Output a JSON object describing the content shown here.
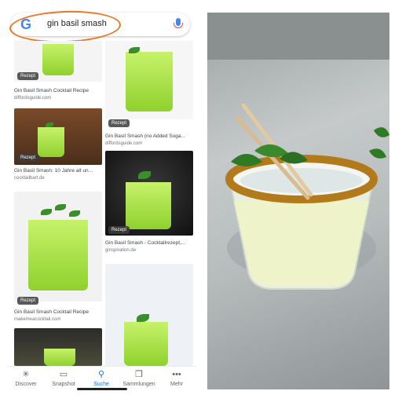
{
  "search": {
    "logo": "G",
    "query": "gin basil smash"
  },
  "results": [
    {
      "badge": "Rezept",
      "title": "Gin Basil Smash Cocktail Recipe",
      "source": "diffordsguide.com"
    },
    {
      "badge": "Rezept",
      "title": "Gin Basil Smash (no Added Suga...",
      "source": "diffordsguide.com"
    },
    {
      "badge": "Rezept",
      "title": "Gin Basil Smash: 10 Jahre alt un...",
      "source": "cocktailbart.de"
    },
    {
      "badge": "Rezept",
      "title": "Gin Basil Smash - Cocktailrezept,...",
      "source": "ginspiration.de"
    },
    {
      "badge": "Rezept",
      "title": "Gin Basil Smash Cocktail Recipe",
      "source": "makemeacocktail.com"
    }
  ],
  "tabs": [
    {
      "label": "Discover",
      "icon": "asterisk-icon"
    },
    {
      "label": "Snapshot",
      "icon": "snapshot-icon"
    },
    {
      "label": "Suche",
      "icon": "search-icon"
    },
    {
      "label": "Sammlungen",
      "icon": "collections-icon"
    },
    {
      "label": "Mehr",
      "icon": "more-icon"
    }
  ],
  "colors": {
    "accent": "#1a73e8",
    "highlight": "#f07622",
    "drink": "#a8e04a"
  }
}
